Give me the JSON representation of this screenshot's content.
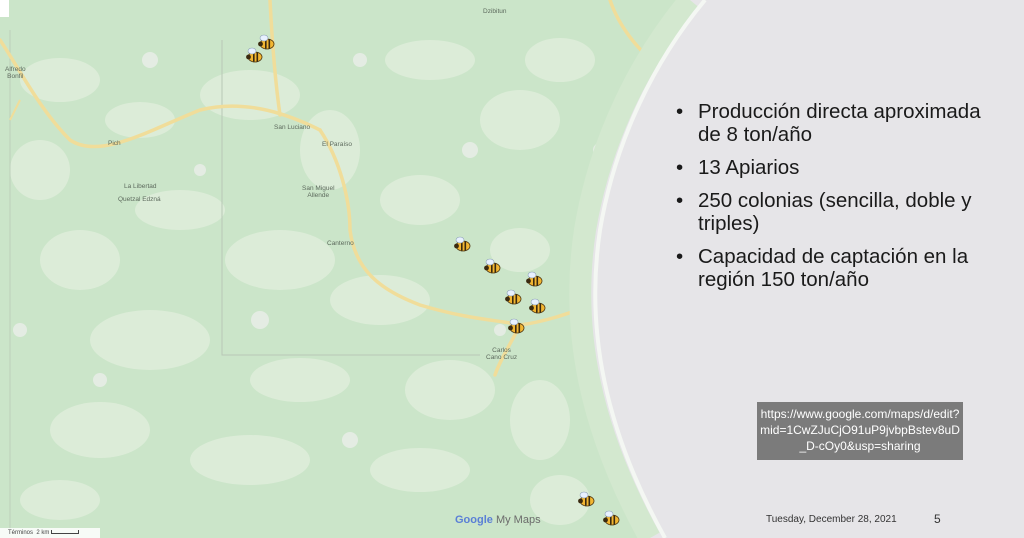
{
  "map": {
    "places": [
      {
        "id": "alfredo",
        "label": "Alfredo\nBonfil"
      },
      {
        "id": "pich",
        "label": "Pich"
      },
      {
        "id": "san-luciano",
        "label": "San Luciano"
      },
      {
        "id": "el-paraiso",
        "label": "El Paraíso"
      },
      {
        "id": "la-libertad",
        "label": "La Libertad"
      },
      {
        "id": "quetzal",
        "label": "Quetzal Edzná"
      },
      {
        "id": "san-miguel",
        "label": "San Miguel\nAllende"
      },
      {
        "id": "canterno",
        "label": "Canterno"
      },
      {
        "id": "dzibitun",
        "label": "Dzibitun"
      },
      {
        "id": "carlos-cano",
        "label": "Carlos\nCano Cruz"
      }
    ],
    "apiaries_icon": "bee-icon",
    "attribution": {
      "terms": "Términos",
      "scale": "2 km"
    },
    "brand": {
      "google": "Google",
      "suffix": "My Maps"
    }
  },
  "slide": {
    "bullets": [
      "Producción directa aproximada de  8 ton/año",
      "13 Apiarios",
      "250 colonias (sencilla, doble y triples)",
      "Capacidad de captación en la región 150 ton/año"
    ],
    "link_text": "https://www.google.com/maps/d/edit?mid=1CwZJuCjO91uP9jvbpBstev8uD_D-cOy0&usp=sharing",
    "date": "Tuesday, December 28, 2021",
    "page_number": "5"
  },
  "colors": {
    "map_green": "#cfe7cd",
    "map_light": "#e3f0e0",
    "road": "#f2e3a8",
    "panel": "#e6e5e8",
    "link_box": "#7b7b7b"
  }
}
